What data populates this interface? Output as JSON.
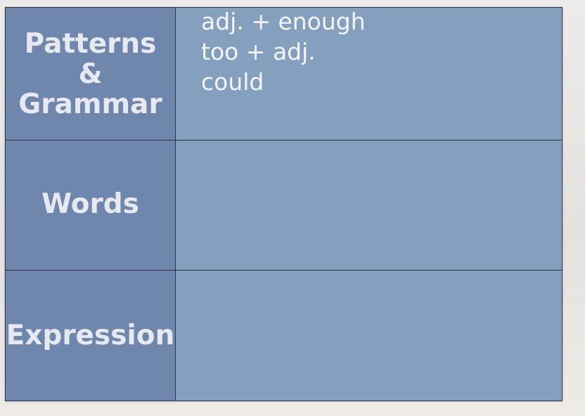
{
  "table": {
    "rows": [
      {
        "label_lines": [
          "Patterns",
          "&",
          "Grammar"
        ],
        "content": [
          "adj. + enough",
          "too + adj.",
          "could"
        ]
      },
      {
        "label_lines": [
          "Words"
        ],
        "content": []
      },
      {
        "label_lines": [
          "Expression"
        ],
        "content": []
      }
    ]
  },
  "colors": {
    "label_column_bg": "#6f87ac",
    "content_column_bg": "#859fbf",
    "grid_lines": "#2b3547",
    "text": "#eef1f6"
  }
}
